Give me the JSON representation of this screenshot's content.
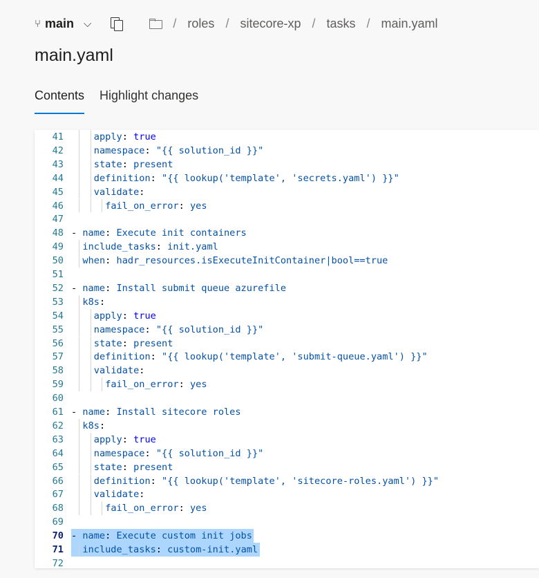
{
  "header": {
    "branch": "main",
    "breadcrumb": [
      "roles",
      "sitecore-xp",
      "tasks",
      "main.yaml"
    ],
    "separator": "/"
  },
  "file_title": "main.yaml",
  "tabs": [
    {
      "label": "Contents",
      "active": true
    },
    {
      "label": "Highlight changes",
      "active": false
    }
  ],
  "code": {
    "selected_lines": [
      70,
      71
    ],
    "lines": [
      {
        "n": "41",
        "parts": [
          [
            "k",
            "apply"
          ],
          [
            "p",
            ": "
          ],
          [
            "b",
            "true"
          ]
        ],
        "indent": 4
      },
      {
        "n": "42",
        "parts": [
          [
            "k",
            "namespace"
          ],
          [
            "p",
            ": "
          ],
          [
            "v",
            "\"{{ solution_id }}\""
          ]
        ],
        "indent": 4
      },
      {
        "n": "43",
        "parts": [
          [
            "k",
            "state"
          ],
          [
            "p",
            ": "
          ],
          [
            "v",
            "present"
          ]
        ],
        "indent": 4
      },
      {
        "n": "44",
        "parts": [
          [
            "k",
            "definition"
          ],
          [
            "p",
            ": "
          ],
          [
            "v",
            "\"{{ lookup('template', 'secrets.yaml') }}\""
          ]
        ],
        "indent": 4
      },
      {
        "n": "45",
        "parts": [
          [
            "k",
            "validate"
          ],
          [
            "p",
            ":"
          ]
        ],
        "indent": 4
      },
      {
        "n": "46",
        "parts": [
          [
            "k",
            "fail_on_error"
          ],
          [
            "p",
            ": "
          ],
          [
            "v",
            "yes"
          ]
        ],
        "indent": 6
      },
      {
        "n": "47",
        "parts": [],
        "indent": 0
      },
      {
        "n": "48",
        "parts": [
          [
            "d",
            "- "
          ],
          [
            "k",
            "name"
          ],
          [
            "p",
            ": "
          ],
          [
            "v",
            "Execute init containers"
          ]
        ],
        "indent": 0
      },
      {
        "n": "49",
        "parts": [
          [
            "k",
            "include_tasks"
          ],
          [
            "p",
            ": "
          ],
          [
            "v",
            "init.yaml"
          ]
        ],
        "indent": 2
      },
      {
        "n": "50",
        "parts": [
          [
            "k",
            "when"
          ],
          [
            "p",
            ": "
          ],
          [
            "v",
            "hadr_resources.isExecuteInitContainer|bool==true"
          ]
        ],
        "indent": 2
      },
      {
        "n": "51",
        "parts": [],
        "indent": 0
      },
      {
        "n": "52",
        "parts": [
          [
            "d",
            "- "
          ],
          [
            "k",
            "name"
          ],
          [
            "p",
            ": "
          ],
          [
            "v",
            "Install submit queue azurefile"
          ]
        ],
        "indent": 0
      },
      {
        "n": "53",
        "parts": [
          [
            "k",
            "k8s"
          ],
          [
            "p",
            ":"
          ]
        ],
        "indent": 2
      },
      {
        "n": "54",
        "parts": [
          [
            "k",
            "apply"
          ],
          [
            "p",
            ": "
          ],
          [
            "b",
            "true"
          ]
        ],
        "indent": 4
      },
      {
        "n": "55",
        "parts": [
          [
            "k",
            "namespace"
          ],
          [
            "p",
            ": "
          ],
          [
            "v",
            "\"{{ solution_id }}\""
          ]
        ],
        "indent": 4
      },
      {
        "n": "56",
        "parts": [
          [
            "k",
            "state"
          ],
          [
            "p",
            ": "
          ],
          [
            "v",
            "present"
          ]
        ],
        "indent": 4
      },
      {
        "n": "57",
        "parts": [
          [
            "k",
            "definition"
          ],
          [
            "p",
            ": "
          ],
          [
            "v",
            "\"{{ lookup('template', 'submit-queue.yaml') }}\""
          ]
        ],
        "indent": 4
      },
      {
        "n": "58",
        "parts": [
          [
            "k",
            "validate"
          ],
          [
            "p",
            ":"
          ]
        ],
        "indent": 4
      },
      {
        "n": "59",
        "parts": [
          [
            "k",
            "fail_on_error"
          ],
          [
            "p",
            ": "
          ],
          [
            "v",
            "yes"
          ]
        ],
        "indent": 6
      },
      {
        "n": "60",
        "parts": [],
        "indent": 0
      },
      {
        "n": "61",
        "parts": [
          [
            "d",
            "- "
          ],
          [
            "k",
            "name"
          ],
          [
            "p",
            ": "
          ],
          [
            "v",
            "Install sitecore roles"
          ]
        ],
        "indent": 0
      },
      {
        "n": "62",
        "parts": [
          [
            "k",
            "k8s"
          ],
          [
            "p",
            ":"
          ]
        ],
        "indent": 2
      },
      {
        "n": "63",
        "parts": [
          [
            "k",
            "apply"
          ],
          [
            "p",
            ": "
          ],
          [
            "b",
            "true"
          ]
        ],
        "indent": 4
      },
      {
        "n": "64",
        "parts": [
          [
            "k",
            "namespace"
          ],
          [
            "p",
            ": "
          ],
          [
            "v",
            "\"{{ solution_id }}\""
          ]
        ],
        "indent": 4
      },
      {
        "n": "65",
        "parts": [
          [
            "k",
            "state"
          ],
          [
            "p",
            ": "
          ],
          [
            "v",
            "present"
          ]
        ],
        "indent": 4
      },
      {
        "n": "66",
        "parts": [
          [
            "k",
            "definition"
          ],
          [
            "p",
            ": "
          ],
          [
            "v",
            "\"{{ lookup('template', 'sitecore-roles.yaml') }}\""
          ]
        ],
        "indent": 4
      },
      {
        "n": "67",
        "parts": [
          [
            "k",
            "validate"
          ],
          [
            "p",
            ":"
          ]
        ],
        "indent": 4
      },
      {
        "n": "68",
        "parts": [
          [
            "k",
            "fail_on_error"
          ],
          [
            "p",
            ": "
          ],
          [
            "v",
            "yes"
          ]
        ],
        "indent": 6
      },
      {
        "n": "69",
        "parts": [],
        "indent": 0
      },
      {
        "n": "70",
        "parts": [
          [
            "d",
            "- "
          ],
          [
            "k",
            "name"
          ],
          [
            "p",
            ": "
          ],
          [
            "v",
            "Execute custom init jobs"
          ]
        ],
        "indent": 0
      },
      {
        "n": "71",
        "parts": [
          [
            "k",
            "include_tasks"
          ],
          [
            "p",
            ": "
          ],
          [
            "v",
            "custom-init.yaml"
          ]
        ],
        "indent": 2
      },
      {
        "n": "72",
        "parts": [],
        "indent": 0
      }
    ]
  }
}
